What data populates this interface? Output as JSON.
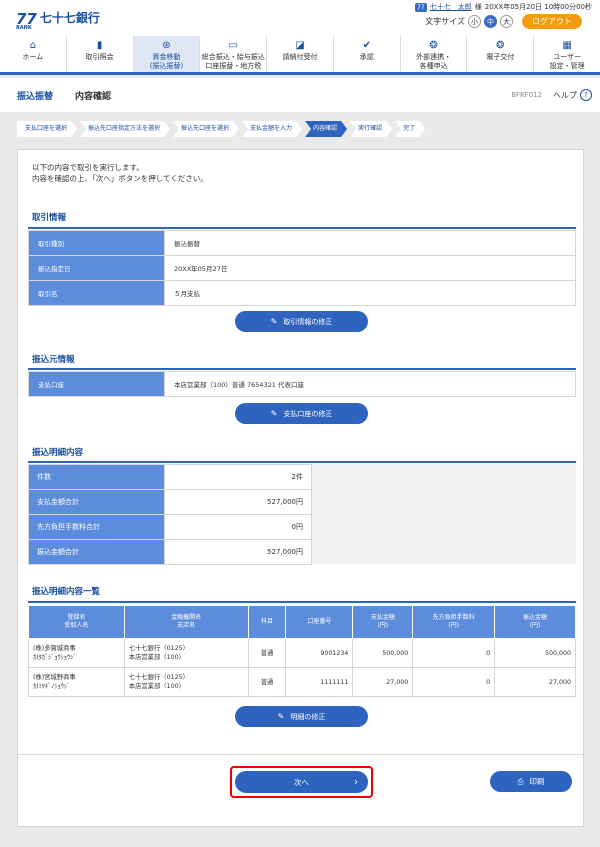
{
  "brand": {
    "mark": "77",
    "bank": "BANK",
    "name": "七十七銀行"
  },
  "user": {
    "badge": "77",
    "name": "七十七　太郎",
    "suffix": "様",
    "datetime": "20XX年05月20日 10時00分00秒"
  },
  "fontsize": {
    "label": "文字サイズ",
    "small": "小",
    "medium": "中",
    "large": "大"
  },
  "logout": "ログアウト",
  "nav": [
    {
      "icon": "home-icon",
      "glyph": "⌂",
      "label": "ホーム"
    },
    {
      "icon": "document-icon",
      "glyph": "▮",
      "label": "取引照会"
    },
    {
      "icon": "transfer-icon",
      "glyph": "⊛",
      "label": "資金移動\n(振込振替)"
    },
    {
      "icon": "card-icon",
      "glyph": "▭",
      "label": "総合振込・給与振込\n口座振替・地方税"
    },
    {
      "icon": "request-icon",
      "glyph": "◪",
      "label": "請納付受付"
    },
    {
      "icon": "approve-icon",
      "glyph": "✔",
      "label": "承認"
    },
    {
      "icon": "link-icon",
      "glyph": "❂",
      "label": "外部連携・\n各種申込"
    },
    {
      "icon": "delivery-icon",
      "glyph": "❂",
      "label": "電子交付"
    },
    {
      "icon": "user-admin-icon",
      "glyph": "▦",
      "label": "ユーザー\n設定・管理"
    }
  ],
  "page": {
    "section": "振込振替",
    "title": "内容確認",
    "code": "BFKF012",
    "help": "ヘルプ",
    "help_q": "?"
  },
  "steps": [
    "支払口座を選択",
    "振込先口座指定方法を選択",
    "振込先口座を選択",
    "支払金額を入力",
    "内容確認",
    "実行確認",
    "完了"
  ],
  "intro": [
    "以下の内容で取引を実行します。",
    "内容を確認の上、「次へ」ボタンを押してください。"
  ],
  "trade": {
    "heading": "取引情報",
    "rows": [
      {
        "label": "取引種別",
        "value": "振込振替"
      },
      {
        "label": "振込指定日",
        "value": "20XX年05月27日"
      },
      {
        "label": "取引名",
        "value": "５月支払"
      }
    ],
    "button": "取引情報の修正"
  },
  "source": {
    "heading": "振込元情報",
    "rows": [
      {
        "label": "支払口座",
        "value": "本店営業部（100）普通 7654321 代表口座"
      }
    ],
    "button": "支払口座の修正"
  },
  "summary": {
    "heading": "振込明細内容",
    "rows": [
      {
        "label": "件数",
        "value": "2件"
      },
      {
        "label": "支払金額合計",
        "value": "527,000円"
      },
      {
        "label": "先方負担手数料合計",
        "value": "0円"
      },
      {
        "label": "振込金額合計",
        "value": "527,000円"
      }
    ]
  },
  "list": {
    "heading": "振込明細内容一覧",
    "headers": [
      "登録名\n受取人名",
      "金融機関名\n支店名",
      "科目",
      "口座番号",
      "支払金額\n(円)",
      "先方負担手数料\n(円)",
      "振込金額\n(円)"
    ],
    "rows": [
      {
        "name": "(株)多賀城商事",
        "kana": "ｶ)ﾀｶﾞｼﾞｮｳｼｮｳｼﾞ",
        "bank": "七十七銀行（0125）",
        "branch": "本店営業部（100）",
        "type": "普通",
        "account": "9001234",
        "pay": "500,000",
        "fee": "0",
        "amount": "500,000"
      },
      {
        "name": "(株)宮城野商事",
        "kana": "ｶ)ﾐﾔｷﾞﾉｼｮｳｼﾞ",
        "bank": "七十七銀行（0125）",
        "branch": "本店営業部（100）",
        "type": "普通",
        "account": "1111111",
        "pay": "27,000",
        "fee": "0",
        "amount": "27,000"
      }
    ],
    "button": "明細の修正"
  },
  "actions": {
    "next": "次へ",
    "next_chev": "›",
    "print": "印刷",
    "pen": "✎",
    "printer": "⎙"
  }
}
